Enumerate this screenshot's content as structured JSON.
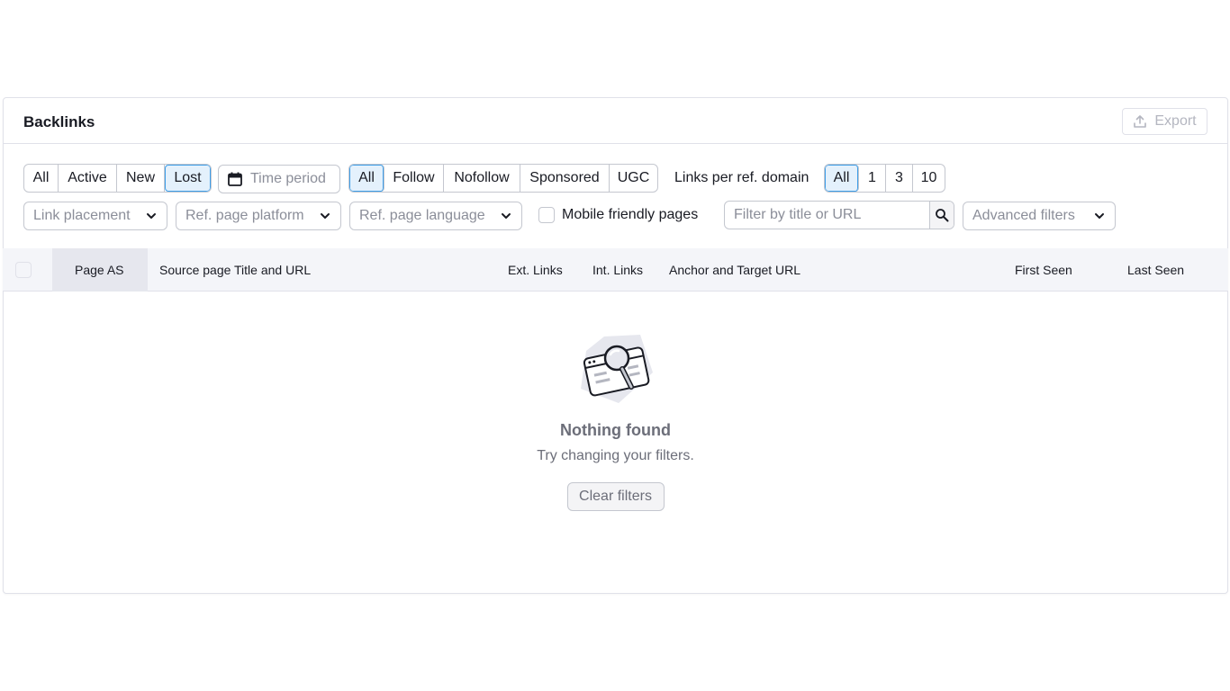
{
  "header": {
    "title": "Backlinks",
    "export_label": "Export"
  },
  "status_tabs": {
    "items": [
      "All",
      "Active",
      "New",
      "Lost"
    ],
    "active": "Lost"
  },
  "time_period": {
    "label": "Time period"
  },
  "link_type_tabs": {
    "items": [
      "All",
      "Follow",
      "Nofollow",
      "Sponsored",
      "UGC"
    ],
    "active": "All"
  },
  "links_per_domain": {
    "label": "Links per ref. domain",
    "items": [
      "All",
      "1",
      "3",
      "10"
    ],
    "active": "All"
  },
  "filters": {
    "link_placement": "Link placement",
    "ref_page_platform": "Ref. page platform",
    "ref_page_language": "Ref. page language",
    "mobile_friendly": "Mobile friendly pages",
    "search_placeholder": "Filter by title or URL",
    "advanced": "Advanced filters"
  },
  "table": {
    "columns": [
      "Page AS",
      "Source page Title and URL",
      "Ext. Links",
      "Int. Links",
      "Anchor and Target URL",
      "First Seen",
      "Last Seen"
    ]
  },
  "empty_state": {
    "title": "Nothing found",
    "subtitle": "Try changing your filters.",
    "button": "Clear filters"
  },
  "colors": {
    "accent": "#3e9ee8",
    "active_bg": "#e4f1fc",
    "header_bg": "#f4f5f9"
  }
}
